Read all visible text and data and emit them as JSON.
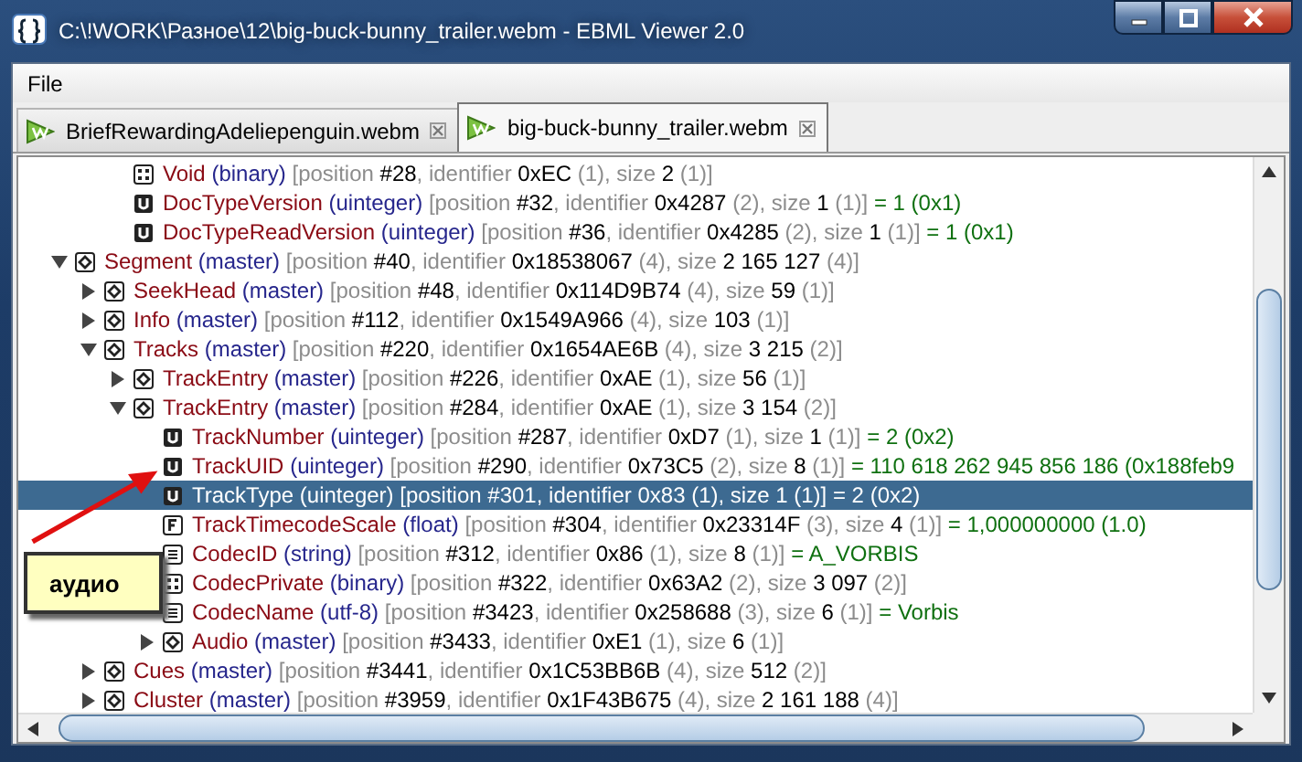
{
  "window": {
    "title": "C:\\!WORK\\Разное\\12\\big-buck-bunny_trailer.webm - EBML Viewer 2.0"
  },
  "menu": [
    {
      "label": "File"
    }
  ],
  "tabs": [
    {
      "label": "BriefRewardingAdeliepenguin.webm",
      "selected": false
    },
    {
      "label": "big-buck-bunny_trailer.webm",
      "selected": true
    }
  ],
  "tree": {
    "items": [
      {
        "children": [
          {
            "kind": "binary",
            "name": "Void",
            "type": "(binary)",
            "info": "[position #28, identifier 0xEC (1), size 2 (1)]",
            "selected": false
          },
          {
            "kind": "uinteger",
            "name": "DocTypeVersion",
            "type": "(uinteger)",
            "info": "[position #32, identifier 0x4287 (2), size 1 (1)]",
            "value": "= 1 (0x1)",
            "selected": false
          },
          {
            "kind": "uinteger",
            "name": "DocTypeReadVersion",
            "type": "(uinteger)",
            "info": "[position #36, identifier 0x4285 (2), size 1 (1)]",
            "value": "= 1 (0x1)",
            "selected": false
          }
        ]
      },
      {
        "kind": "master",
        "name": "Segment",
        "type": "(master)",
        "info": "[position #40, identifier 0x18538067 (4), size 2 165 127 (4)]",
        "selected": false,
        "expanded": true,
        "children": [
          {
            "kind": "master",
            "name": "SeekHead",
            "type": "(master)",
            "info": "[position #48, identifier 0x114D9B74 (4), size 59 (1)]",
            "selected": false,
            "expanded": false
          },
          {
            "kind": "master",
            "name": "Info",
            "type": "(master)",
            "info": "[position #112, identifier 0x1549A966 (4), size 103 (1)]",
            "selected": false,
            "expanded": false
          },
          {
            "kind": "master",
            "name": "Tracks",
            "type": "(master)",
            "info": "[position #220, identifier 0x1654AE6B (4), size 3 215 (2)]",
            "selected": false,
            "expanded": true,
            "children": [
              {
                "kind": "master",
                "name": "TrackEntry",
                "type": "(master)",
                "info": "[position #226, identifier 0xAE (1), size 56 (1)]",
                "selected": false,
                "expanded": false
              },
              {
                "kind": "master",
                "name": "TrackEntry",
                "type": "(master)",
                "info": "[position #284, identifier 0xAE (1), size 3 154 (2)]",
                "selected": false,
                "expanded": true,
                "children": [
                  {
                    "kind": "uinteger",
                    "name": "TrackNumber",
                    "type": "(uinteger)",
                    "info": "[position #287, identifier 0xD7 (1), size 1 (1)]",
                    "value": "= 2 (0x2)",
                    "selected": false
                  },
                  {
                    "kind": "uinteger",
                    "name": "TrackUID",
                    "type": "(uinteger)",
                    "info": "[position #290, identifier 0x73C5 (2), size 8 (1)]",
                    "value": "= 110 618 262 945 856 186 (0x188feb9",
                    "selected": false
                  },
                  {
                    "kind": "uinteger",
                    "name": "TrackType",
                    "type": "(uinteger)",
                    "info": "[position #301, identifier 0x83 (1), size 1 (1)]",
                    "value": "= 2 (0x2)",
                    "selected": true
                  },
                  {
                    "kind": "float",
                    "name": "TrackTimecodeScale",
                    "type": "(float)",
                    "info": "[position #304, identifier 0x23314F (3), size 4 (1)]",
                    "value": "= 1,000000000 (1.0)",
                    "selected": false
                  },
                  {
                    "kind": "string",
                    "name": "CodecID",
                    "type": "(string)",
                    "info": "[position #312, identifier 0x86 (1), size 8 (1)]",
                    "value": "= A_VORBIS",
                    "selected": false
                  },
                  {
                    "kind": "binary",
                    "name": "CodecPrivate",
                    "type": "(binary)",
                    "info": "[position #322, identifier 0x63A2 (2), size 3 097 (2)]",
                    "selected": false
                  },
                  {
                    "kind": "string",
                    "name": "CodecName",
                    "type": "(utf-8)",
                    "info": "[position #3423, identifier 0x258688 (3), size 6 (1)]",
                    "value": "= Vorbis",
                    "selected": false
                  },
                  {
                    "kind": "master",
                    "name": "Audio",
                    "type": "(master)",
                    "info": "[position #3433, identifier 0xE1 (1), size 6 (1)]",
                    "selected": false,
                    "expanded": false
                  }
                ]
              }
            ]
          },
          {
            "kind": "master",
            "name": "Cues",
            "type": "(master)",
            "info": "[position #3441, identifier 0x1C53BB6B (4), size 512 (2)]",
            "selected": false,
            "expanded": false
          },
          {
            "kind": "master",
            "name": "Cluster",
            "type": "(master)",
            "info": "[position #3959, identifier 0x1F43B675 (4), size 2 161 188 (4)]",
            "selected": false,
            "expanded": false
          }
        ]
      }
    ]
  },
  "annotation": {
    "text": "аудио"
  }
}
